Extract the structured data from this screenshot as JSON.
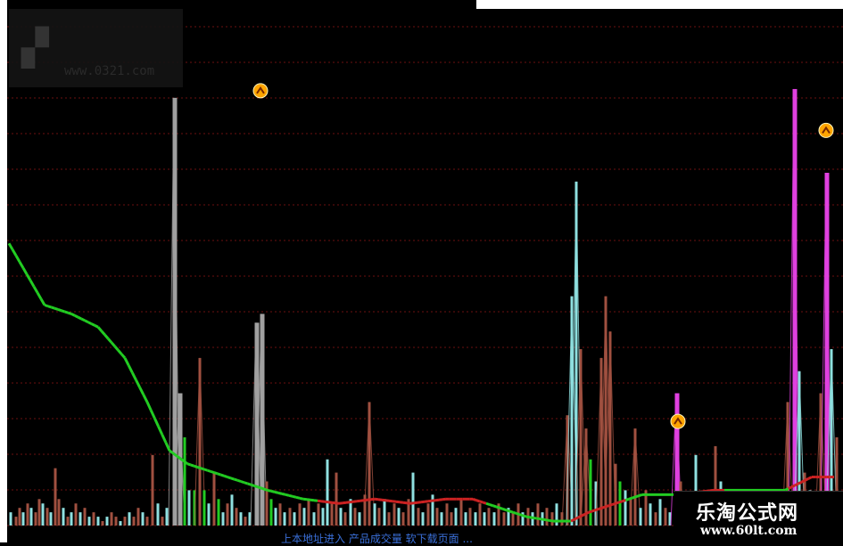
{
  "watermark": {
    "tl_text": "",
    "tl_url": "www.0321.com"
  },
  "site": {
    "name": "乐淘公式网",
    "url": "www.60lt.com"
  },
  "bottom_caption": "上本地址进入  产品成交量  软下载页面 ...",
  "colors": {
    "background": "#000000",
    "grid": "#6b1010",
    "ma_green": "#22cc22",
    "ma_red": "#cc2222",
    "bar_gray": "#a0a0a0",
    "bar_brown": "#a05040",
    "bar_cyan": "#8fe0e0",
    "bar_green": "#22cc22",
    "bar_magenta": "#e040e0",
    "marker": "#ffa500"
  },
  "chart_data": {
    "type": "bar",
    "title": "",
    "xlabel": "",
    "ylabel": "",
    "ylim": [
      0,
      100
    ],
    "grid": true,
    "series": [
      {
        "kind": "bars",
        "values": [
          [
            12,
            3,
            "cyan"
          ],
          [
            18,
            2,
            "brown"
          ],
          [
            22,
            4,
            "brown"
          ],
          [
            26,
            3,
            "cyan"
          ],
          [
            31,
            5,
            "brown"
          ],
          [
            35,
            4,
            "cyan"
          ],
          [
            40,
            3,
            "brown"
          ],
          [
            44,
            6,
            "brown"
          ],
          [
            48,
            5,
            "cyan"
          ],
          [
            53,
            4,
            "brown"
          ],
          [
            57,
            3,
            "cyan"
          ],
          [
            62,
            13,
            "brown"
          ],
          [
            66,
            6,
            "brown"
          ],
          [
            71,
            4,
            "cyan"
          ],
          [
            76,
            2,
            "brown"
          ],
          [
            80,
            3,
            "cyan"
          ],
          [
            85,
            5,
            "brown"
          ],
          [
            90,
            3,
            "cyan"
          ],
          [
            95,
            4,
            "brown"
          ],
          [
            100,
            2,
            "cyan"
          ],
          [
            105,
            3,
            "brown"
          ],
          [
            110,
            2,
            "cyan"
          ],
          [
            115,
            1,
            "brown"
          ],
          [
            120,
            2,
            "cyan"
          ],
          [
            125,
            3,
            "brown"
          ],
          [
            130,
            2,
            "brown"
          ],
          [
            135,
            1,
            "cyan"
          ],
          [
            140,
            2,
            "brown"
          ],
          [
            145,
            3,
            "cyan"
          ],
          [
            150,
            2,
            "brown"
          ],
          [
            155,
            4,
            "brown"
          ],
          [
            160,
            3,
            "cyan"
          ],
          [
            165,
            2,
            "brown"
          ],
          [
            171,
            16,
            "brown"
          ],
          [
            177,
            5,
            "cyan"
          ],
          [
            182,
            2,
            "brown"
          ],
          [
            187,
            4,
            "cyan"
          ],
          [
            195,
            97,
            "gray"
          ],
          [
            201,
            30,
            "gray"
          ],
          [
            207,
            20,
            "green"
          ],
          [
            212,
            8,
            "cyan"
          ],
          [
            218,
            8,
            "green"
          ],
          [
            224,
            38,
            "brown"
          ],
          [
            229,
            8,
            "green"
          ],
          [
            234,
            5,
            "cyan"
          ],
          [
            240,
            12,
            "brown"
          ],
          [
            245,
            6,
            "green"
          ],
          [
            250,
            3,
            "cyan"
          ],
          [
            255,
            5,
            "brown"
          ],
          [
            260,
            7,
            "cyan"
          ],
          [
            265,
            4,
            "brown"
          ],
          [
            270,
            3,
            "cyan"
          ],
          [
            275,
            2,
            "brown"
          ],
          [
            280,
            3,
            "cyan"
          ],
          [
            287,
            46,
            "gray"
          ],
          [
            293,
            48,
            "gray"
          ],
          [
            299,
            10,
            "brown"
          ],
          [
            304,
            6,
            "green"
          ],
          [
            309,
            4,
            "cyan"
          ],
          [
            314,
            5,
            "brown"
          ],
          [
            319,
            3,
            "cyan"
          ],
          [
            325,
            4,
            "brown"
          ],
          [
            330,
            3,
            "cyan"
          ],
          [
            336,
            5,
            "brown"
          ],
          [
            341,
            4,
            "cyan"
          ],
          [
            346,
            6,
            "brown"
          ],
          [
            352,
            3,
            "cyan"
          ],
          [
            357,
            5,
            "brown"
          ],
          [
            362,
            4,
            "cyan"
          ],
          [
            367,
            15,
            "cyan"
          ],
          [
            372,
            5,
            "brown"
          ],
          [
            377,
            12,
            "brown"
          ],
          [
            382,
            4,
            "cyan"
          ],
          [
            387,
            3,
            "brown"
          ],
          [
            393,
            6,
            "cyan"
          ],
          [
            398,
            4,
            "brown"
          ],
          [
            403,
            3,
            "cyan"
          ],
          [
            409,
            7,
            "brown"
          ],
          [
            414,
            28,
            "brown"
          ],
          [
            420,
            5,
            "cyan"
          ],
          [
            425,
            4,
            "brown"
          ],
          [
            431,
            6,
            "cyan"
          ],
          [
            436,
            3,
            "brown"
          ],
          [
            442,
            5,
            "brown"
          ],
          [
            447,
            4,
            "cyan"
          ],
          [
            452,
            3,
            "brown"
          ],
          [
            458,
            6,
            "brown"
          ],
          [
            463,
            12,
            "cyan"
          ],
          [
            469,
            4,
            "brown"
          ],
          [
            474,
            3,
            "cyan"
          ],
          [
            480,
            5,
            "brown"
          ],
          [
            485,
            7,
            "cyan"
          ],
          [
            490,
            4,
            "brown"
          ],
          [
            495,
            3,
            "cyan"
          ],
          [
            501,
            5,
            "brown"
          ],
          [
            506,
            3,
            "brown"
          ],
          [
            511,
            4,
            "cyan"
          ],
          [
            517,
            6,
            "brown"
          ],
          [
            522,
            3,
            "cyan"
          ],
          [
            527,
            4,
            "brown"
          ],
          [
            533,
            3,
            "cyan"
          ],
          [
            538,
            5,
            "brown"
          ],
          [
            543,
            3,
            "cyan"
          ],
          [
            548,
            4,
            "brown"
          ],
          [
            554,
            3,
            "cyan"
          ],
          [
            559,
            5,
            "brown"
          ],
          [
            565,
            3,
            "brown"
          ],
          [
            570,
            4,
            "cyan"
          ],
          [
            575,
            3,
            "brown"
          ],
          [
            581,
            5,
            "brown"
          ],
          [
            586,
            3,
            "cyan"
          ],
          [
            592,
            4,
            "brown"
          ],
          [
            597,
            3,
            "cyan"
          ],
          [
            603,
            5,
            "brown"
          ],
          [
            608,
            3,
            "cyan"
          ],
          [
            613,
            4,
            "brown"
          ],
          [
            619,
            3,
            "brown"
          ],
          [
            624,
            5,
            "cyan"
          ],
          [
            630,
            3,
            "brown"
          ],
          [
            636,
            25,
            "brown"
          ],
          [
            641,
            52,
            "cyan"
          ],
          [
            646,
            78,
            "cyan"
          ],
          [
            651,
            40,
            "brown"
          ],
          [
            657,
            22,
            "brown"
          ],
          [
            662,
            15,
            "green"
          ],
          [
            668,
            10,
            "cyan"
          ],
          [
            674,
            38,
            "brown"
          ],
          [
            679,
            52,
            "brown"
          ],
          [
            684,
            44,
            "brown"
          ],
          [
            690,
            14,
            "brown"
          ],
          [
            695,
            10,
            "green"
          ],
          [
            701,
            8,
            "cyan"
          ],
          [
            707,
            6,
            "brown"
          ],
          [
            712,
            22,
            "brown"
          ],
          [
            718,
            4,
            "cyan"
          ],
          [
            724,
            8,
            "brown"
          ],
          [
            729,
            5,
            "cyan"
          ],
          [
            735,
            3,
            "brown"
          ],
          [
            740,
            6,
            "cyan"
          ],
          [
            746,
            4,
            "brown"
          ],
          [
            751,
            3,
            "cyan"
          ],
          [
            758,
            30,
            "magenta"
          ],
          [
            763,
            10,
            "brown"
          ],
          [
            769,
            5,
            "cyan"
          ],
          [
            774,
            4,
            "brown"
          ],
          [
            780,
            16,
            "cyan"
          ],
          [
            785,
            3,
            "brown"
          ],
          [
            790,
            6,
            "cyan"
          ],
          [
            796,
            8,
            "brown"
          ],
          [
            802,
            18,
            "brown"
          ],
          [
            808,
            10,
            "cyan"
          ],
          [
            813,
            4,
            "brown"
          ],
          [
            819,
            6,
            "cyan"
          ],
          [
            825,
            3,
            "brown"
          ],
          [
            830,
            5,
            "cyan"
          ],
          [
            836,
            8,
            "brown"
          ],
          [
            842,
            3,
            "cyan"
          ],
          [
            848,
            5,
            "brown"
          ],
          [
            853,
            4,
            "cyan"
          ],
          [
            859,
            6,
            "brown"
          ],
          [
            865,
            3,
            "cyan"
          ],
          [
            871,
            4,
            "brown"
          ],
          [
            877,
            5,
            "cyan"
          ],
          [
            883,
            28,
            "brown"
          ],
          [
            890,
            99,
            "magenta"
          ],
          [
            896,
            35,
            "cyan"
          ],
          [
            902,
            12,
            "brown"
          ],
          [
            908,
            8,
            "cyan"
          ],
          [
            914,
            6,
            "brown"
          ],
          [
            920,
            30,
            "brown"
          ],
          [
            926,
            80,
            "magenta"
          ],
          [
            932,
            40,
            "cyan"
          ],
          [
            938,
            20,
            "brown"
          ]
        ]
      },
      {
        "kind": "line",
        "values": [
          [
            10,
            64
          ],
          [
            30,
            57
          ],
          [
            50,
            50
          ],
          [
            80,
            48
          ],
          [
            110,
            45
          ],
          [
            140,
            38
          ],
          [
            165,
            28
          ],
          [
            190,
            17
          ],
          [
            210,
            14
          ],
          [
            240,
            12
          ],
          [
            270,
            10
          ],
          [
            300,
            8
          ],
          [
            340,
            6
          ],
          [
            380,
            5
          ],
          [
            420,
            6
          ],
          [
            460,
            5
          ],
          [
            500,
            6
          ],
          [
            530,
            6
          ],
          [
            560,
            4
          ],
          [
            590,
            2
          ],
          [
            620,
            1
          ],
          [
            640,
            1
          ],
          [
            660,
            3
          ],
          [
            690,
            5
          ],
          [
            720,
            7
          ],
          [
            760,
            7
          ],
          [
            800,
            8
          ],
          [
            840,
            8
          ],
          [
            880,
            8
          ],
          [
            910,
            11
          ],
          [
            935,
            11
          ]
        ],
        "red_ranges": [
          [
            355,
            545
          ],
          [
            640,
            700
          ],
          [
            760,
            810
          ],
          [
            885,
            935
          ]
        ]
      }
    ],
    "markers": [
      [
        292,
        97
      ],
      [
        760,
        22
      ],
      [
        926,
        88
      ]
    ]
  }
}
